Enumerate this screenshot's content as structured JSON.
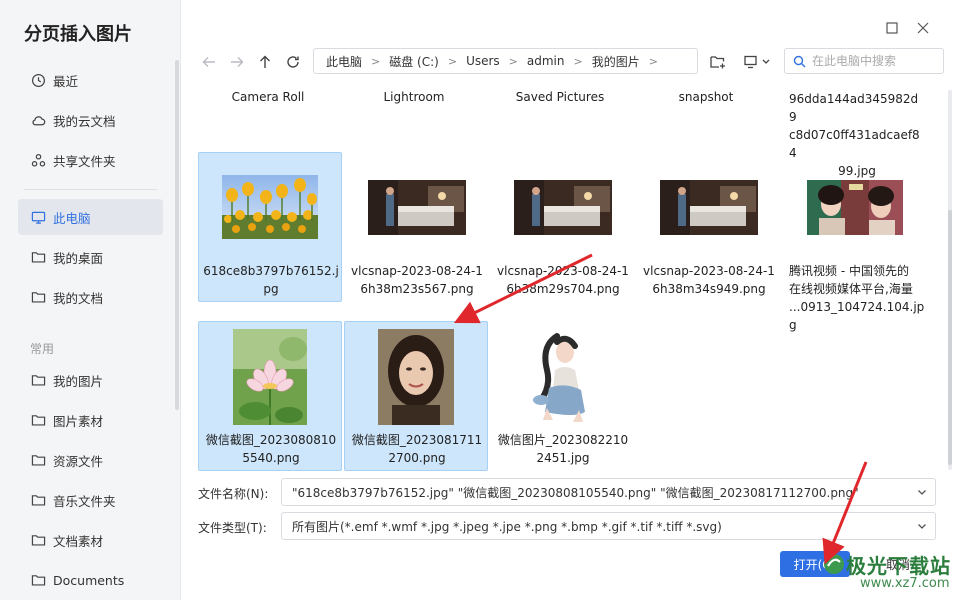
{
  "sidebar": {
    "title": "分页插入图片",
    "items": [
      {
        "label": "最近",
        "icon": "clock-icon"
      },
      {
        "label": "我的云文档",
        "icon": "cloud-icon"
      },
      {
        "label": "共享文件夹",
        "icon": "share-icon"
      },
      {
        "label": "此电脑",
        "icon": "monitor-icon",
        "active": true
      },
      {
        "label": "我的桌面",
        "icon": "folder-icon"
      },
      {
        "label": "我的文档",
        "icon": "folder-icon"
      },
      {
        "label": "我的图片",
        "icon": "folder-icon"
      },
      {
        "label": "图片素材",
        "icon": "folder-icon"
      },
      {
        "label": "资源文件",
        "icon": "folder-icon"
      },
      {
        "label": "音乐文件夹",
        "icon": "folder-icon"
      },
      {
        "label": "文档素材",
        "icon": "folder-icon"
      },
      {
        "label": "Documents",
        "icon": "folder-icon"
      }
    ],
    "section_label": "常用"
  },
  "breadcrumb": [
    "此电脑",
    "磁盘 (C:)",
    "Users",
    "admin",
    "我的图片"
  ],
  "search": {
    "placeholder": "在此电脑中搜索"
  },
  "folders": [
    "Camera Roll",
    "Lightroom",
    "Saved Pictures",
    "snapshot"
  ],
  "files": [
    {
      "name": "96dda144ad345982d9c8d07c0ff431adcaef8499.jpg",
      "lines": [
        "96dda144ad345982d9",
        "c8d07c0ff431adcaef84",
        "99.jpg"
      ]
    },
    {
      "name": "618ce8b3797b76152.jpg",
      "lines": [
        "618ce8b3797b76152.j",
        "pg"
      ],
      "selected": true
    },
    {
      "name": "vlcsnap-2023-08-24-16h38m23s567.png",
      "lines": [
        "vlcsnap-2023-08-24-1",
        "6h38m23s567.png"
      ]
    },
    {
      "name": "vlcsnap-2023-08-24-16h38m29s704.png",
      "lines": [
        "vlcsnap-2023-08-24-1",
        "6h38m29s704.png"
      ]
    },
    {
      "name": "vlcsnap-2023-08-24-16h38m34s949.png",
      "lines": [
        "vlcsnap-2023-08-24-1",
        "6h38m34s949.png"
      ]
    },
    {
      "name": "腾讯视频 - 中国领先的在线视频媒体平台,海量...0913_104724.104.jpg",
      "lines": [
        "腾讯视频 - 中国领先的",
        "在线视频媒体平台,海量",
        "...0913_104724.104.jpg"
      ]
    },
    {
      "name": "微信截图_20230808105540.png",
      "lines": [
        "微信截图_2023080810",
        "5540.png"
      ],
      "selected": true
    },
    {
      "name": "微信截图_20230817112700.png",
      "lines": [
        "微信截图_2023081711",
        "2700.png"
      ],
      "selected": true
    },
    {
      "name": "微信图片_20230822102451.jpg",
      "lines": [
        "微信图片_2023082210",
        "2451.jpg"
      ]
    }
  ],
  "form": {
    "filename_label": "文件名称(N):",
    "filename_value": "\"618ce8b3797b76152.jpg\" \"微信截图_20230808105540.png\" \"微信截图_20230817112700.png\"",
    "filetype_label": "文件类型(T):",
    "filetype_value": "所有图片(*.emf *.wmf *.jpg *.jpeg *.jpe *.png *.bmp *.gif *.tif *.tiff *.svg)",
    "open_label": "打开(O)",
    "cancel_label": "取消"
  },
  "watermark": {
    "brand": "极光下载站",
    "site": "www.xz7.com"
  },
  "colors": {
    "accent": "#2f6fe4",
    "selection": "#cde6fb",
    "annotation_arrow": "#e0282c"
  }
}
